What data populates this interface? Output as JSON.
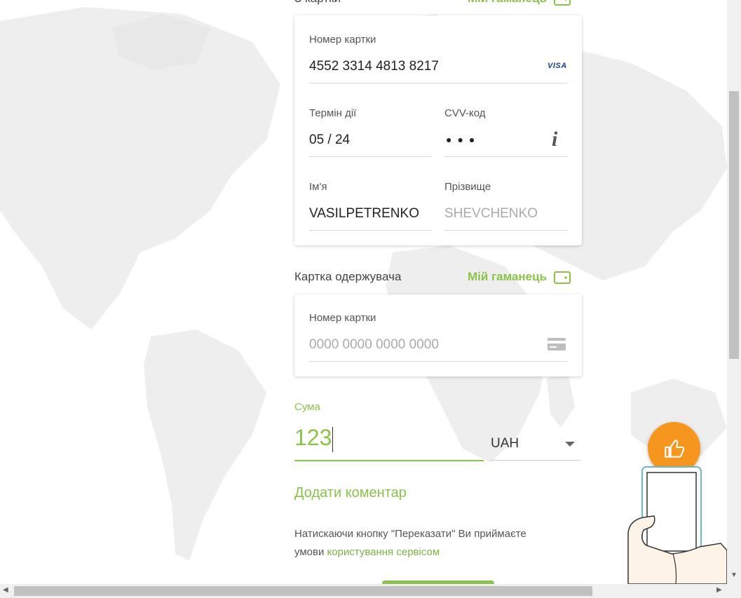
{
  "colors": {
    "accent": "#8bc34a",
    "like_button": "#f7961e",
    "card_brand": "#1a3d8f"
  },
  "sender": {
    "section_label": "З картки",
    "wallet_link": "Мій гаманець",
    "card_number_label": "Номер картки",
    "card_number_value": "4552 3314 4813 8217",
    "card_brand": "VISA",
    "expiry_label": "Термін дії",
    "expiry_value": "05 / 24",
    "cvv_label": "CVV-код",
    "cvv_value": "●●●",
    "cvv_info_icon": "i",
    "first_name_label": "Ім'я",
    "first_name_value": "VASILPETRENKO",
    "last_name_label": "Прізвище",
    "last_name_placeholder": "SHEVCHENKO"
  },
  "recipient": {
    "section_label": "Картка одержувача",
    "wallet_link": "Мій гаманець",
    "card_number_label": "Номер картки",
    "card_number_placeholder": "0000 0000 0000 0000",
    "card_icon": "credit-card-icon"
  },
  "amount": {
    "label": "Сума",
    "value": "123",
    "currency": "UAH"
  },
  "comment_link": "Додати коментар",
  "terms": {
    "text": "Натискаючи кнопку \"Переказати\" Ви приймаєте умови",
    "link": "користування сервісом"
  },
  "widgets": {
    "like_icon": "thumbs-up-icon",
    "chat_icon": "chat-bubble-icon"
  }
}
